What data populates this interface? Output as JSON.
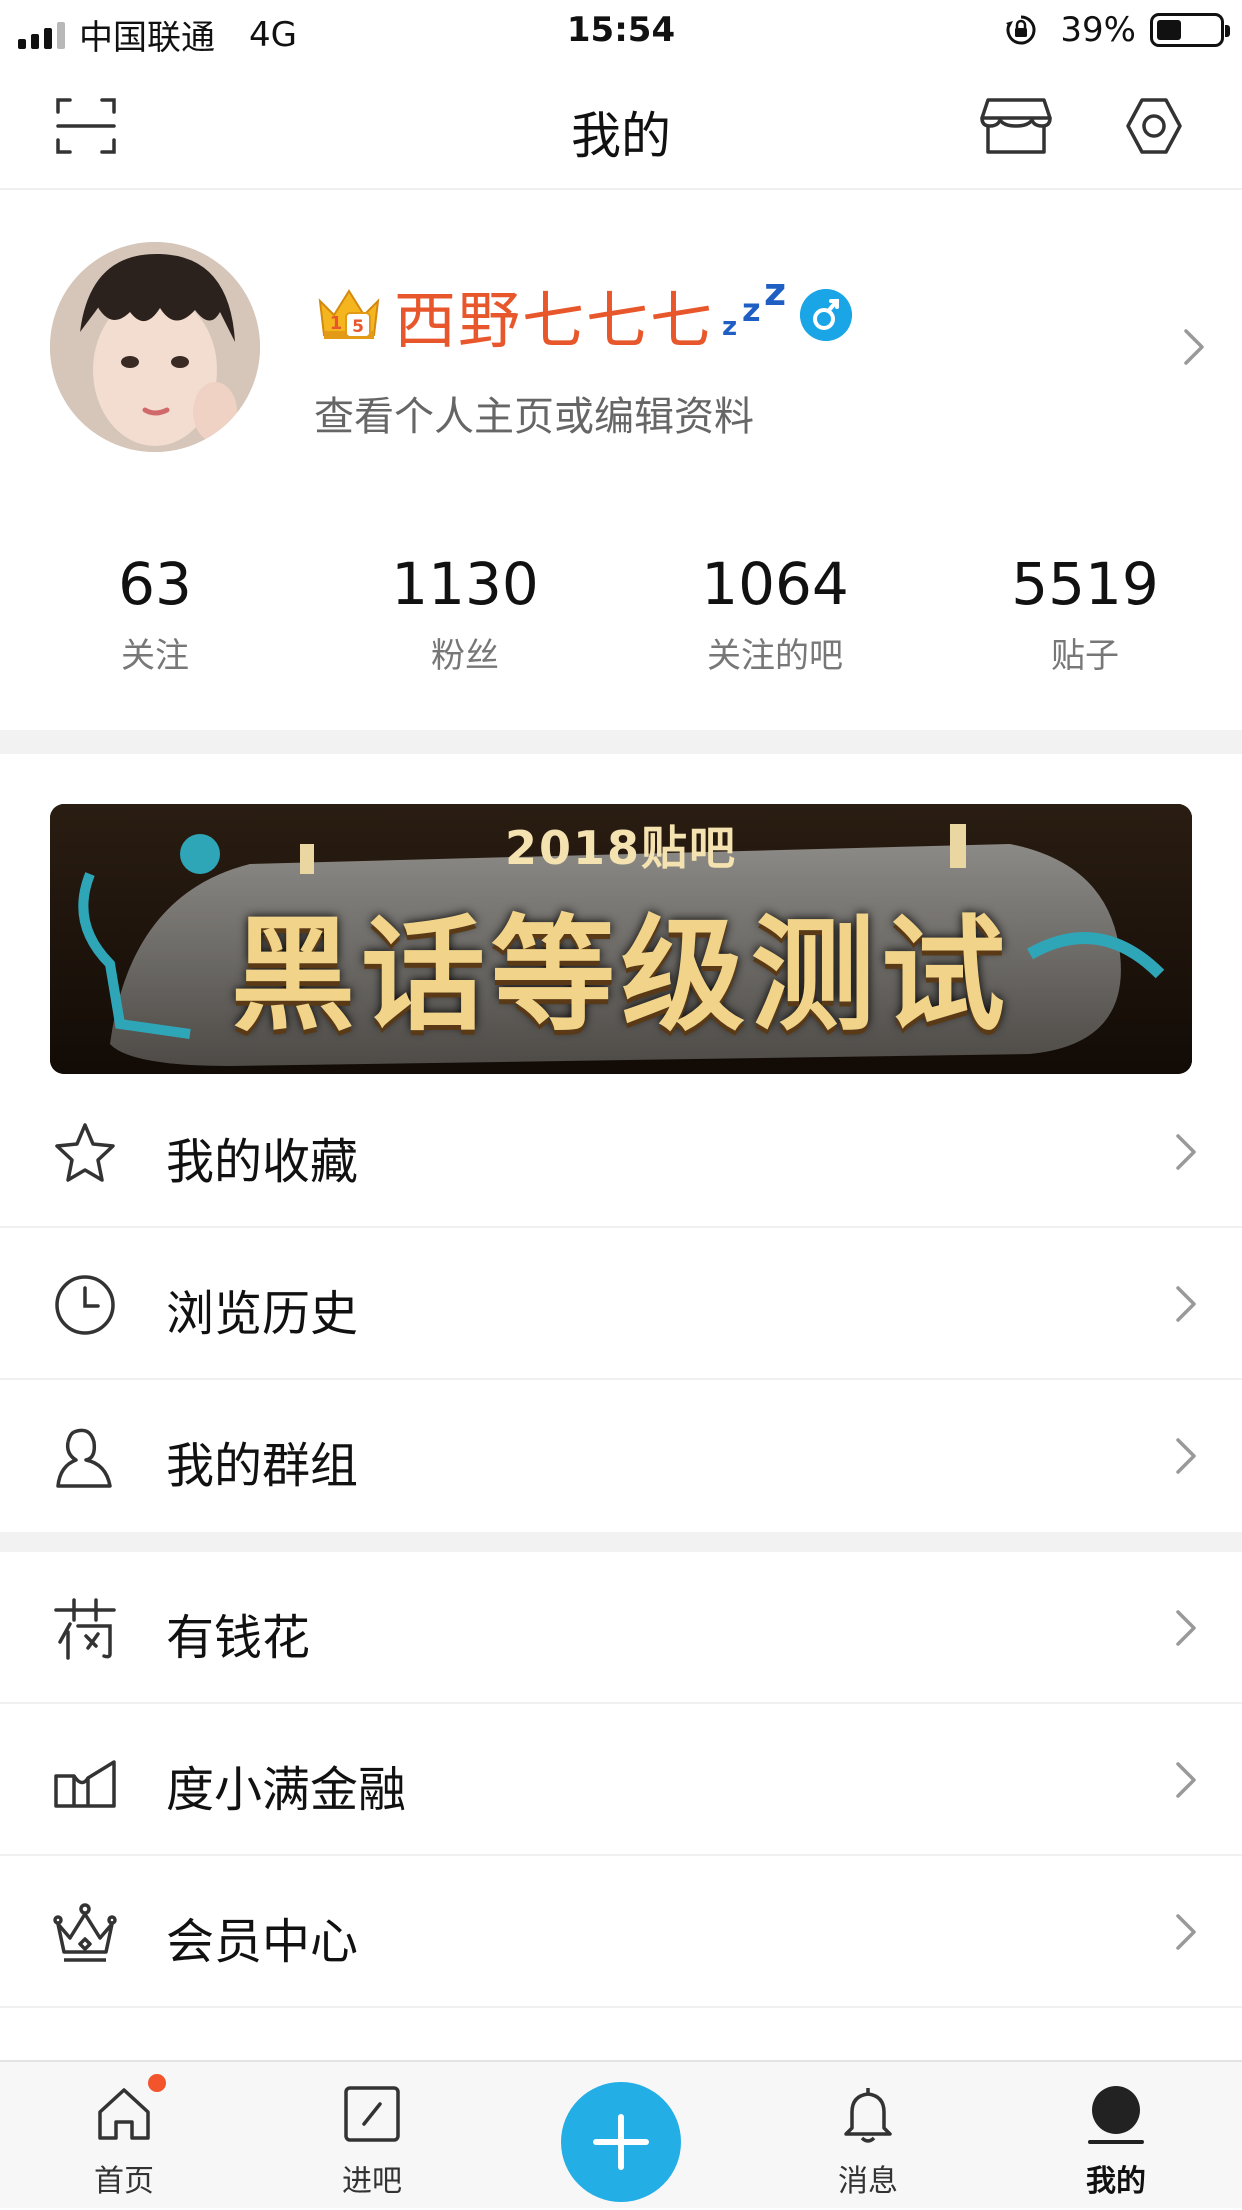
{
  "status_bar": {
    "carrier": "中国联通",
    "network": "4G",
    "time": "15:54",
    "battery": "39%"
  },
  "header": {
    "title": "我的",
    "left_icon": "scan-icon",
    "right_icons": [
      "store-icon",
      "settings-icon"
    ]
  },
  "profile": {
    "username": "西野七七七",
    "subtitle": "查看个人主页或编辑资料",
    "badge_icons": [
      "crown-level-icon",
      "sleep-zzz-icon",
      "male-gender-icon"
    ]
  },
  "stats": [
    {
      "value": "63",
      "label": "关注"
    },
    {
      "value": "1130",
      "label": "粉丝"
    },
    {
      "value": "1064",
      "label": "关注的吧"
    },
    {
      "value": "5519",
      "label": "贴子"
    }
  ],
  "banner": {
    "year_text": "2018贴吧",
    "headline": "黑话等级测试"
  },
  "menu": [
    {
      "label": "我的收藏",
      "icon": "star-icon"
    },
    {
      "label": "浏览历史",
      "icon": "clock-icon"
    },
    {
      "label": "我的群组",
      "icon": "user-group-icon"
    },
    {
      "label": "有钱花",
      "icon": "money-icon"
    },
    {
      "label": "度小满金融",
      "icon": "finance-icon"
    },
    {
      "label": "会员中心",
      "icon": "crown-icon"
    }
  ],
  "tabbar": [
    {
      "label": "首页",
      "icon": "home-icon",
      "has_dot": true
    },
    {
      "label": "进吧",
      "icon": "enter-bar-icon"
    },
    {
      "label": "",
      "icon": "plus-icon"
    },
    {
      "label": "消息",
      "icon": "bell-icon"
    },
    {
      "label": "我的",
      "icon": "profile-icon",
      "active": true
    }
  ],
  "colors": {
    "accent_blue": "#23aee6",
    "username_orange": "#e8572b",
    "badge_red": "#f2552c"
  }
}
